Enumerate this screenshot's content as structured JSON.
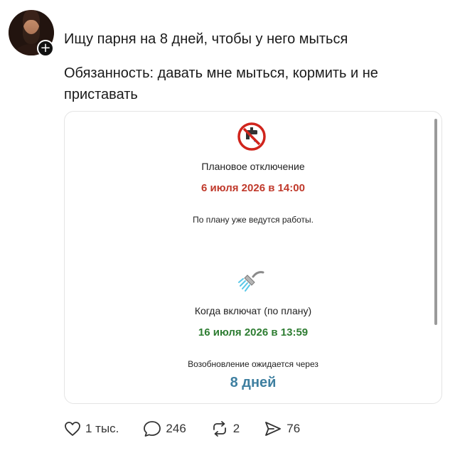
{
  "post": {
    "line1": "Ищу парня на 8 дней, чтобы у него мыться",
    "line2": "Обязанность: давать мне мыться, кормить и не приставать",
    "follow_icon": "+"
  },
  "card": {
    "outage_label": "Плановое отключение",
    "outage_date": "6 июля 2026 в 14:00",
    "works_note": "По плану уже ведутся работы.",
    "restore_label": "Когда включат (по плану)",
    "restore_date": "16 июля 2026 в 13:59",
    "resume_label": "Возобновление ожидается через",
    "resume_value": "8 дней",
    "icons": [
      "no-water-icon",
      "shower-icon"
    ]
  },
  "actions": {
    "likes": "1 тыс.",
    "comments": "246",
    "reposts": "2",
    "shares": "76"
  },
  "colors": {
    "red": "#c0392b",
    "green": "#2e7d32",
    "blue": "#3e7fa0"
  }
}
